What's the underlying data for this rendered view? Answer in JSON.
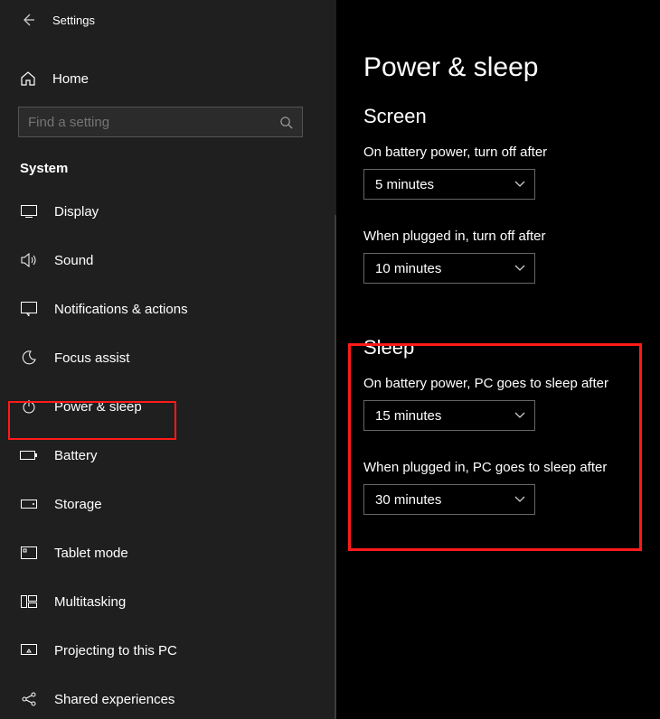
{
  "app": {
    "title": "Settings"
  },
  "home": {
    "label": "Home"
  },
  "search": {
    "placeholder": "Find a setting"
  },
  "section": {
    "title": "System"
  },
  "nav": {
    "items": [
      {
        "label": "Display"
      },
      {
        "label": "Sound"
      },
      {
        "label": "Notifications & actions"
      },
      {
        "label": "Focus assist"
      },
      {
        "label": "Power & sleep"
      },
      {
        "label": "Battery"
      },
      {
        "label": "Storage"
      },
      {
        "label": "Tablet mode"
      },
      {
        "label": "Multitasking"
      },
      {
        "label": "Projecting to this PC"
      },
      {
        "label": "Shared experiences"
      }
    ]
  },
  "page": {
    "title": "Power & sleep",
    "screen": {
      "heading": "Screen",
      "battery_label": "On battery power, turn off after",
      "battery_value": "5 minutes",
      "plugged_label": "When plugged in, turn off after",
      "plugged_value": "10 minutes"
    },
    "sleep": {
      "heading": "Sleep",
      "battery_label": "On battery power, PC goes to sleep after",
      "battery_value": "15 minutes",
      "plugged_label": "When plugged in, PC goes to sleep after",
      "plugged_value": "30 minutes"
    }
  }
}
